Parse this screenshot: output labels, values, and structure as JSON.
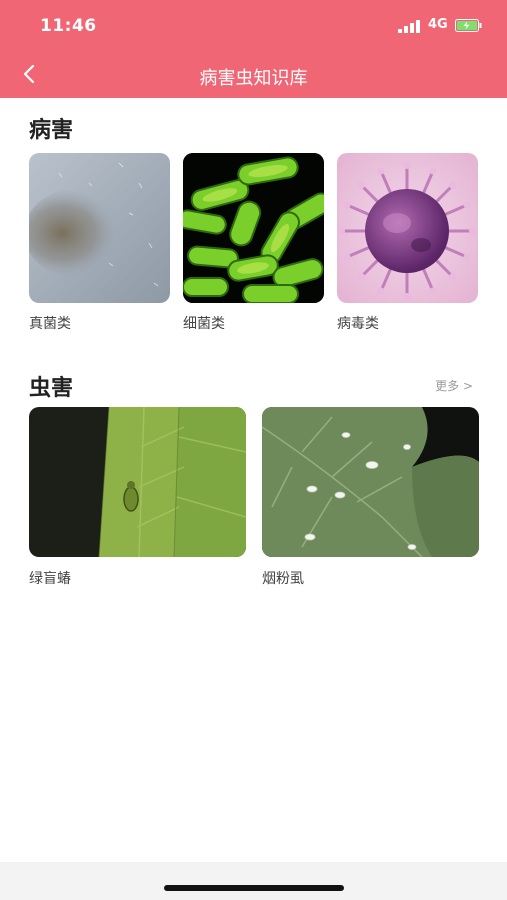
{
  "status_bar": {
    "time": "11:46",
    "network": "4G"
  },
  "nav": {
    "title": "病害虫知识库"
  },
  "disease": {
    "heading": "病害",
    "items": [
      {
        "label": "真菌类"
      },
      {
        "label": "细菌类"
      },
      {
        "label": "病毒类"
      }
    ]
  },
  "pest": {
    "heading": "虫害",
    "more": "更多 >",
    "items": [
      {
        "label": "绿盲蝽"
      },
      {
        "label": "烟粉虱"
      }
    ]
  },
  "colors": {
    "header": "#f06674",
    "text": "#222222",
    "caption": "#444444"
  }
}
